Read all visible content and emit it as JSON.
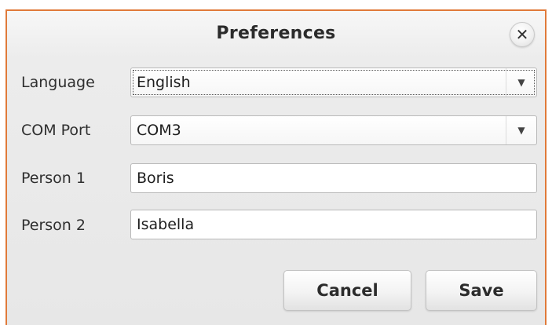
{
  "dialog": {
    "title": "Preferences",
    "close_icon": "close-icon"
  },
  "fields": {
    "language": {
      "label": "Language",
      "value": "English"
    },
    "com_port": {
      "label": "COM Port",
      "value": "COM3"
    },
    "person1": {
      "label": "Person 1",
      "value": "Boris"
    },
    "person2": {
      "label": "Person 2",
      "value": "Isabella"
    }
  },
  "buttons": {
    "cancel": "Cancel",
    "save": "Save"
  },
  "colors": {
    "dialog_border": "#e07a3a"
  }
}
